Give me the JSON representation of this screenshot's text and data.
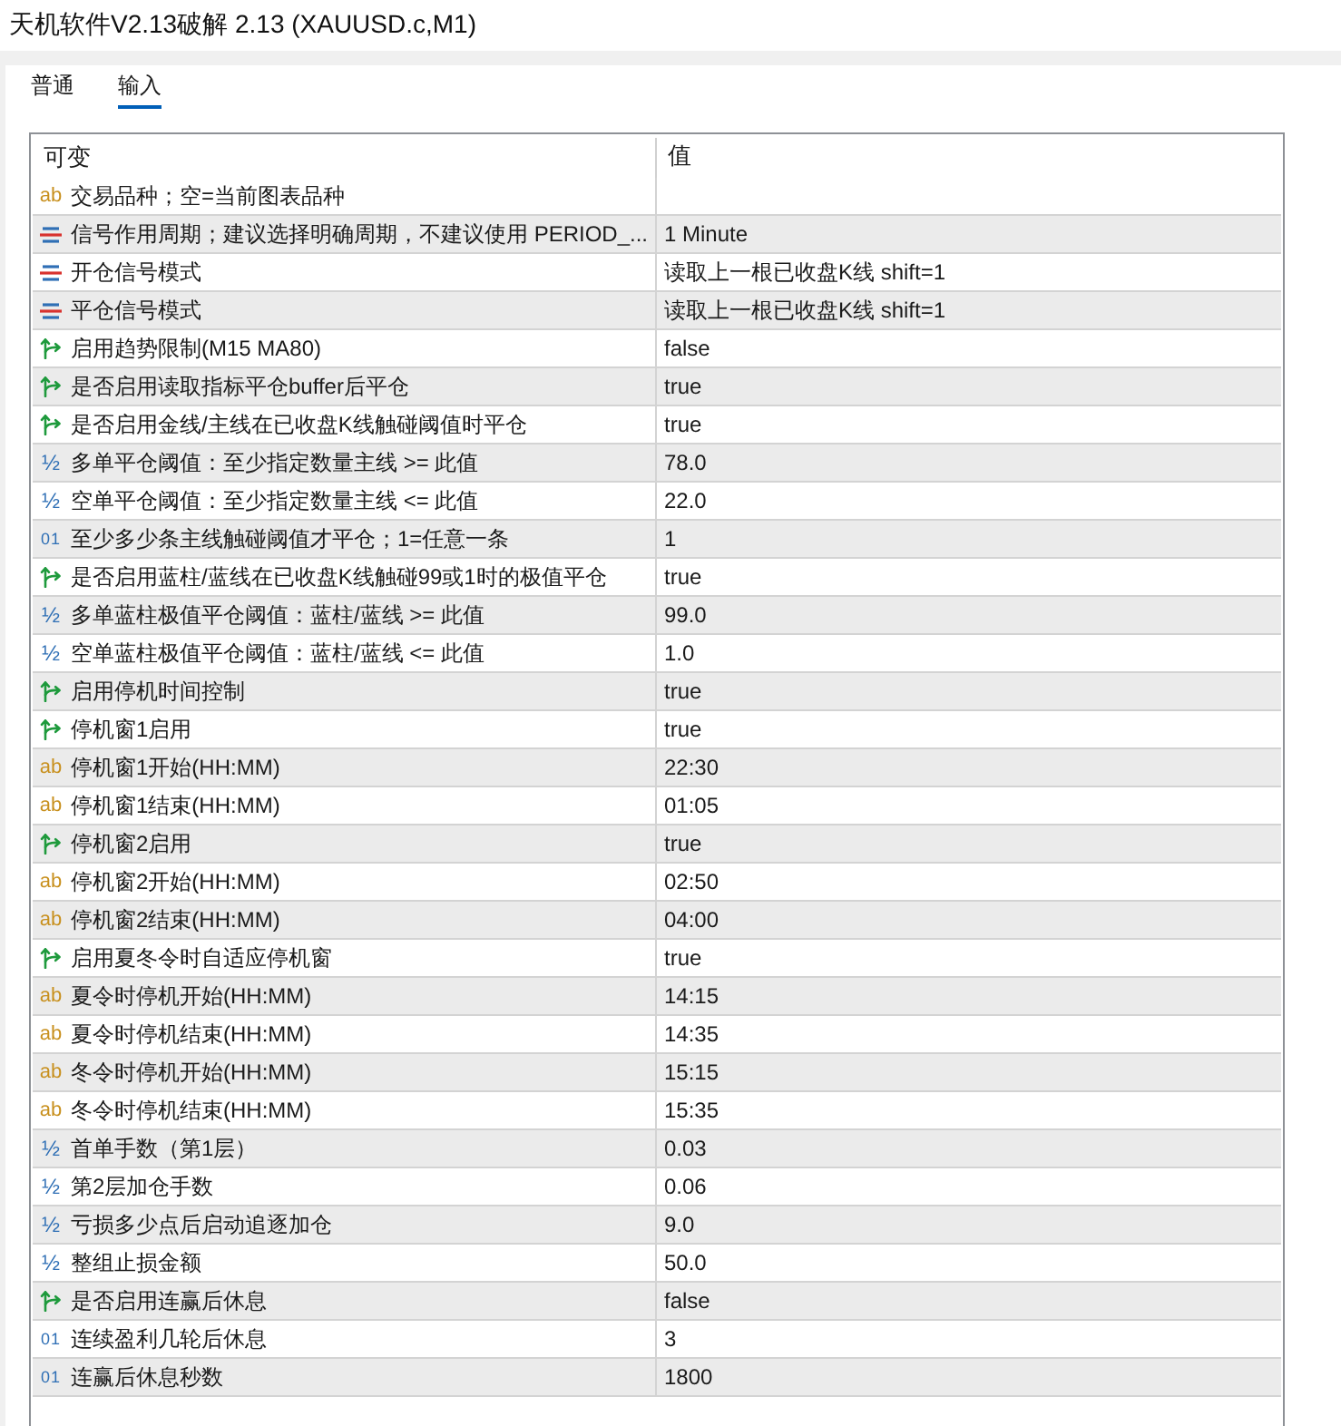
{
  "window": {
    "title": "天机软件V2.13破解 2.13 (XAUUSD.c,M1)"
  },
  "tabs": [
    {
      "label": "普通",
      "selected": false
    },
    {
      "label": "输入",
      "selected": true
    }
  ],
  "table": {
    "columns": [
      "可变",
      "值"
    ],
    "rows": [
      {
        "kind": "string",
        "icon": "ab",
        "name": "交易品种；空=当前图表品种"
      },
      {
        "kind": "enum",
        "name": "信号作用周期；建议选择明确周期，不建议使用 PERIOD_...",
        "value": "1 Minute"
      },
      {
        "kind": "enum",
        "name": "开仓信号模式",
        "value": "读取上一根已收盘K线 shift=1"
      },
      {
        "kind": "enum",
        "name": "平仓信号模式",
        "value": "读取上一根已收盘K线 shift=1"
      },
      {
        "kind": "bool",
        "name": "启用趋势限制(M15 MA80)",
        "value": "false"
      },
      {
        "kind": "bool",
        "name": "是否启用读取指标平仓buffer后平仓",
        "value": "true"
      },
      {
        "kind": "bool",
        "name": "是否启用金线/主线在已收盘K线触碰阈值时平仓",
        "value": "true"
      },
      {
        "kind": "double",
        "icon": "½",
        "name": "多单平仓阈值：至少指定数量主线 >= 此值",
        "value": "78.0"
      },
      {
        "kind": "double",
        "icon": "½",
        "name": "空单平仓阈值：至少指定数量主线 <= 此值",
        "value": "22.0"
      },
      {
        "kind": "int",
        "icon": "01",
        "name": "至少多少条主线触碰阈值才平仓；1=任意一条",
        "value": "1"
      },
      {
        "kind": "bool",
        "name": "是否启用蓝柱/蓝线在已收盘K线触碰99或1时的极值平仓",
        "value": "true"
      },
      {
        "kind": "double",
        "icon": "½",
        "name": "多单蓝柱极值平仓阈值：蓝柱/蓝线 >= 此值",
        "value": "99.0"
      },
      {
        "kind": "double",
        "icon": "½",
        "name": "空单蓝柱极值平仓阈值：蓝柱/蓝线 <= 此值",
        "value": "1.0"
      },
      {
        "kind": "bool",
        "name": "启用停机时间控制",
        "value": "true"
      },
      {
        "kind": "bool",
        "name": "停机窗1启用",
        "value": "true"
      },
      {
        "kind": "string",
        "icon": "ab",
        "name": "停机窗1开始(HH:MM)",
        "value": "22:30"
      },
      {
        "kind": "string",
        "icon": "ab",
        "name": "停机窗1结束(HH:MM)",
        "value": "01:05"
      },
      {
        "kind": "bool",
        "name": "停机窗2启用",
        "value": "true"
      },
      {
        "kind": "string",
        "icon": "ab",
        "name": "停机窗2开始(HH:MM)",
        "value": "02:50"
      },
      {
        "kind": "string",
        "icon": "ab",
        "name": "停机窗2结束(HH:MM)",
        "value": "04:00"
      },
      {
        "kind": "bool",
        "name": "启用夏冬令时自适应停机窗",
        "value": "true"
      },
      {
        "kind": "string",
        "icon": "ab",
        "name": "夏令时停机开始(HH:MM)",
        "value": "14:15"
      },
      {
        "kind": "string",
        "icon": "ab",
        "name": "夏令时停机结束(HH:MM)",
        "value": "14:35"
      },
      {
        "kind": "string",
        "icon": "ab",
        "name": "冬令时停机开始(HH:MM)",
        "value": "15:15"
      },
      {
        "kind": "string",
        "icon": "ab",
        "name": "冬令时停机结束(HH:MM)",
        "value": "15:35"
      },
      {
        "kind": "double",
        "icon": "½",
        "name": "首单手数（第1层）",
        "value": "0.03"
      },
      {
        "kind": "double",
        "icon": "½",
        "name": "第2层加仓手数",
        "value": "0.06"
      },
      {
        "kind": "double",
        "icon": "½",
        "name": "亏损多少点后启动追逐加仓",
        "value": "9.0"
      },
      {
        "kind": "double",
        "icon": "½",
        "name": "整组止损金额",
        "value": "50.0"
      },
      {
        "kind": "bool",
        "name": "是否启用连赢后休息",
        "value": "false"
      },
      {
        "kind": "int",
        "icon": "01",
        "name": "连续盈利几轮后休息",
        "value": "3"
      },
      {
        "kind": "int",
        "icon": "01",
        "name": "连赢后休息秒数",
        "value": "1800"
      }
    ]
  }
}
